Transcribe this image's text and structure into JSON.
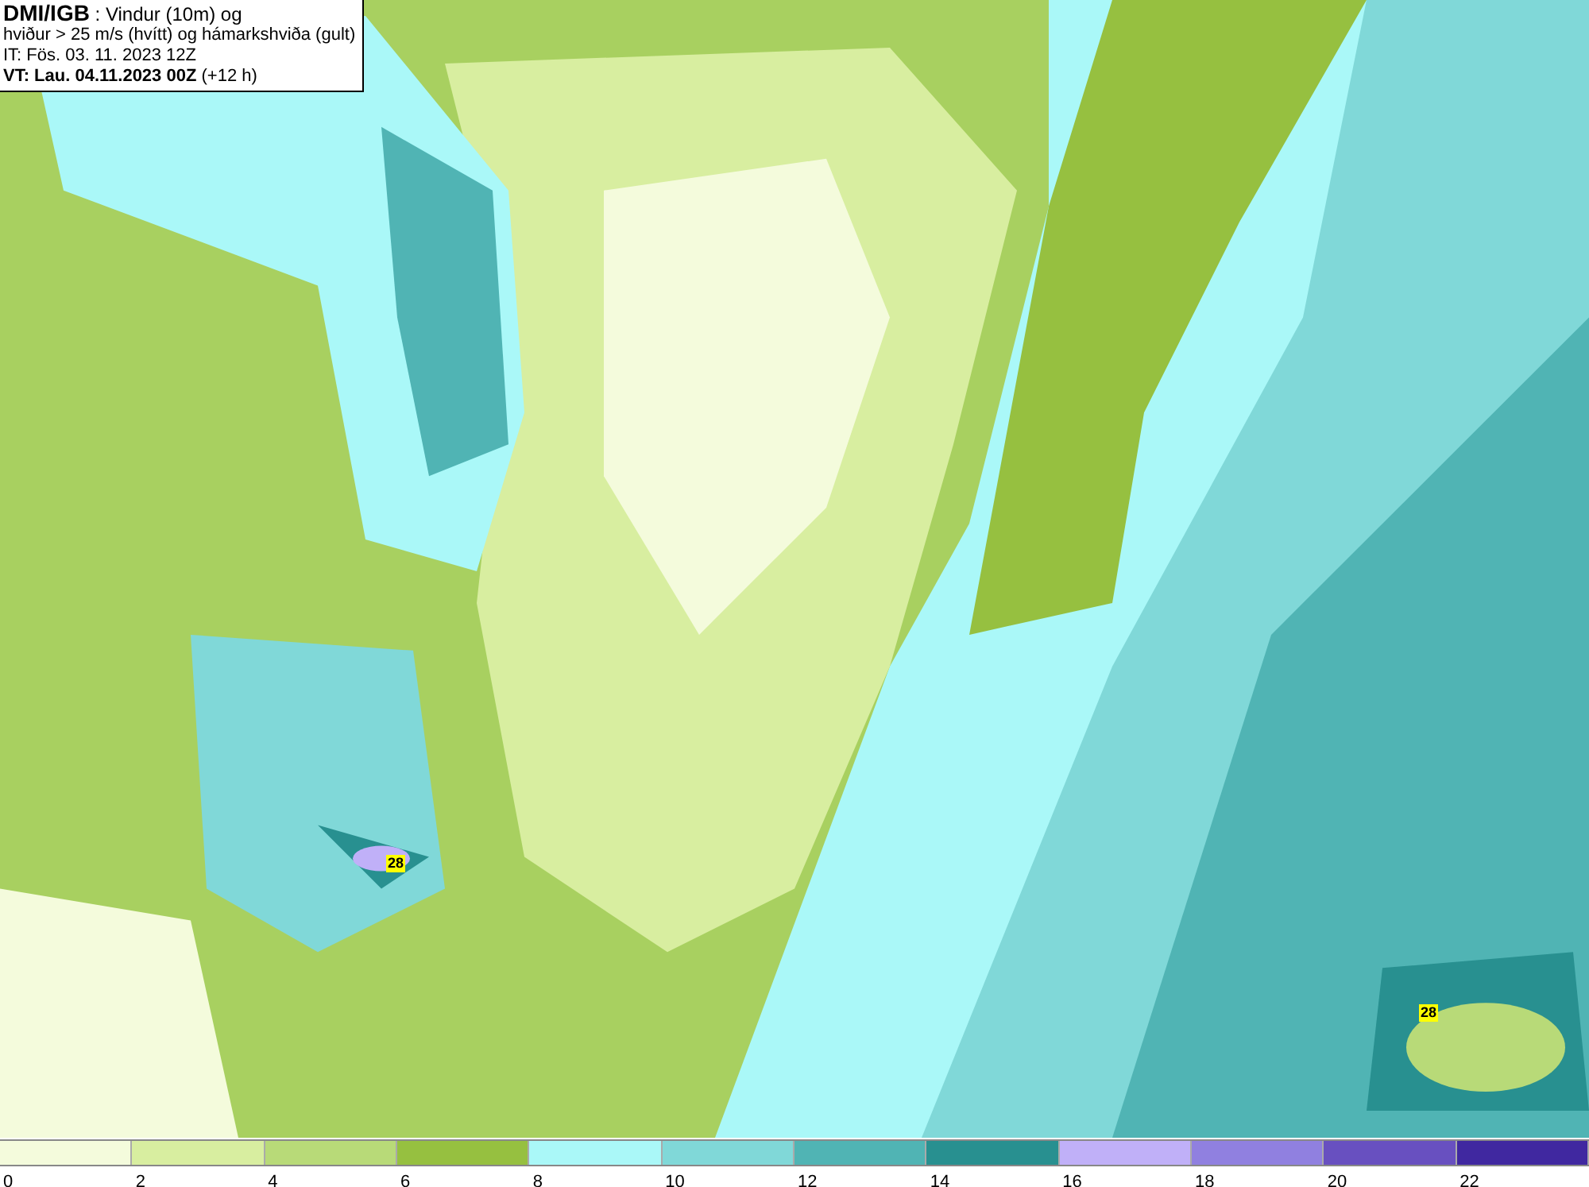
{
  "title_box": {
    "lines": [
      "**DMI/IGB** : Vindur (10m) og",
      "hviður > 25 m/s (hvítt) og hámarkshviða (gult)",
      "IT: Fös. 03. 11. 2023 12Z",
      "**VT: Lau. 04.11.2023 00Z** (+12 h)"
    ]
  },
  "gust_labels": [
    "28",
    "28"
  ],
  "legend": [
    {
      "label": "0",
      "color": "#f4fbdc"
    },
    {
      "label": "2",
      "color": "#d8eea0"
    },
    {
      "label": "4",
      "color": "#b8da78"
    },
    {
      "label": "6",
      "color": "#96c040"
    },
    {
      "label": "8",
      "color": "#aaf8f8"
    },
    {
      "label": "10",
      "color": "#80d8d8"
    },
    {
      "label": "12",
      "color": "#50b4b4"
    },
    {
      "label": "14",
      "color": "#289090"
    },
    {
      "label": "16",
      "color": "#c0b0f8"
    },
    {
      "label": "18",
      "color": "#9080e0"
    },
    {
      "label": "20",
      "color": "#6850c0"
    },
    {
      "label": "22",
      "color": "#4028a0"
    }
  ]
}
